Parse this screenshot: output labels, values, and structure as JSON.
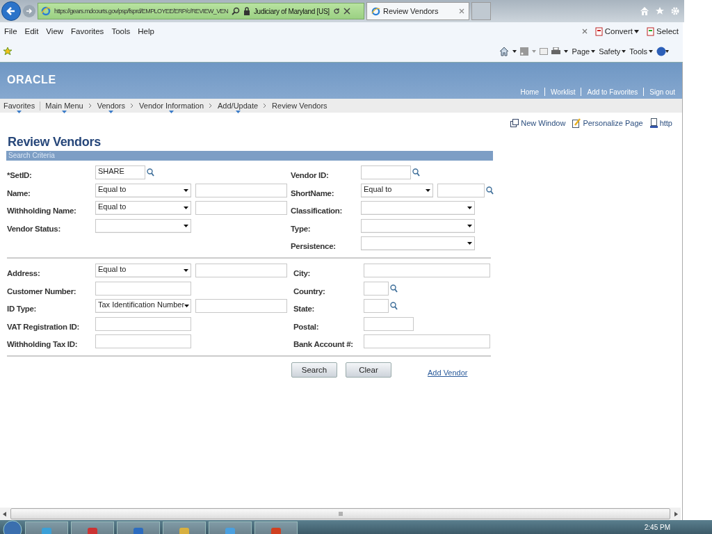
{
  "browser": {
    "address": "https://gears.mdcourts.gov/psp/fsprd/EMPLOYEE/ERP/c/REVIEW_VEN",
    "site": "Judiciary of Maryland [US]",
    "tab": "Review Vendors",
    "menu": [
      "File",
      "Edit",
      "View",
      "Favorites",
      "Tools",
      "Help"
    ],
    "command_right": [
      "Convert",
      "Select"
    ],
    "toolbar": [
      "Page",
      "Safety",
      "Tools"
    ]
  },
  "header": {
    "logo": "ORACLE",
    "links": [
      "Home",
      "Worklist",
      "Add to Favorites",
      "Sign out"
    ]
  },
  "breadcrumbs": [
    {
      "label": "Favorites",
      "dropdown": true
    },
    {
      "label": "Main Menu",
      "dropdown": true
    },
    {
      "label": "Vendors",
      "dropdown": true
    },
    {
      "label": "Vendor Information",
      "dropdown": true
    },
    {
      "label": "Add/Update",
      "dropdown": true
    },
    {
      "label": "Review Vendors",
      "dropdown": false
    }
  ],
  "page_links": [
    "New Window",
    "Personalize Page",
    "http"
  ],
  "title": "Review Vendors",
  "section_title": "Search Criteria",
  "sections": [
    {
      "left": [
        {
          "label": "*SetID:",
          "controls": [
            {
              "kind": "lookup",
              "value": "SHARE"
            }
          ]
        },
        {
          "label": "Name:",
          "controls": [
            {
              "kind": "select",
              "value": "Equal to"
            },
            {
              "kind": "text"
            }
          ]
        },
        {
          "label": "Withholding Name:",
          "controls": [
            {
              "kind": "select",
              "value": "Equal to"
            },
            {
              "kind": "text"
            }
          ]
        },
        {
          "label": "Vendor Status:",
          "controls": [
            {
              "kind": "select"
            }
          ]
        }
      ],
      "right": [
        {
          "label": "Vendor ID:",
          "controls": [
            {
              "kind": "lookup"
            }
          ]
        },
        {
          "label": "ShortName:",
          "controls": [
            {
              "kind": "select",
              "value": "Equal to"
            },
            {
              "kind": "lookup"
            }
          ]
        },
        {
          "label": "Classification:",
          "controls": [
            {
              "kind": "select"
            }
          ]
        },
        {
          "label": "Type:",
          "controls": [
            {
              "kind": "select"
            }
          ]
        },
        {
          "label": "Persistence:",
          "controls": [
            {
              "kind": "select"
            }
          ]
        }
      ]
    },
    {
      "left": [
        {
          "label": "Address:",
          "controls": [
            {
              "kind": "select",
              "value": "Equal to"
            },
            {
              "kind": "text"
            }
          ]
        },
        {
          "label": "Customer Number:",
          "controls": [
            {
              "kind": "text"
            }
          ]
        },
        {
          "label": "ID Type:",
          "controls": [
            {
              "kind": "select",
              "value": "Tax Identification Number"
            },
            {
              "kind": "text"
            }
          ]
        },
        {
          "label": "VAT Registration ID:",
          "controls": [
            {
              "kind": "text"
            }
          ]
        },
        {
          "label": "Withholding Tax ID:",
          "controls": [
            {
              "kind": "text"
            }
          ]
        }
      ],
      "right": [
        {
          "label": "City:",
          "controls": [
            {
              "kind": "text"
            }
          ]
        },
        {
          "label": "Country:",
          "controls": [
            {
              "kind": "lookup"
            }
          ]
        },
        {
          "label": "State:",
          "controls": [
            {
              "kind": "lookup"
            }
          ]
        },
        {
          "label": "Postal:",
          "controls": [
            {
              "kind": "text"
            }
          ]
        },
        {
          "label": "Bank Account #:",
          "controls": [
            {
              "kind": "text"
            }
          ]
        }
      ]
    }
  ],
  "buttons": [
    "Search",
    "Clear"
  ],
  "add_link": "Add Vendor",
  "taskbar": {
    "time": "2:45 PM"
  }
}
